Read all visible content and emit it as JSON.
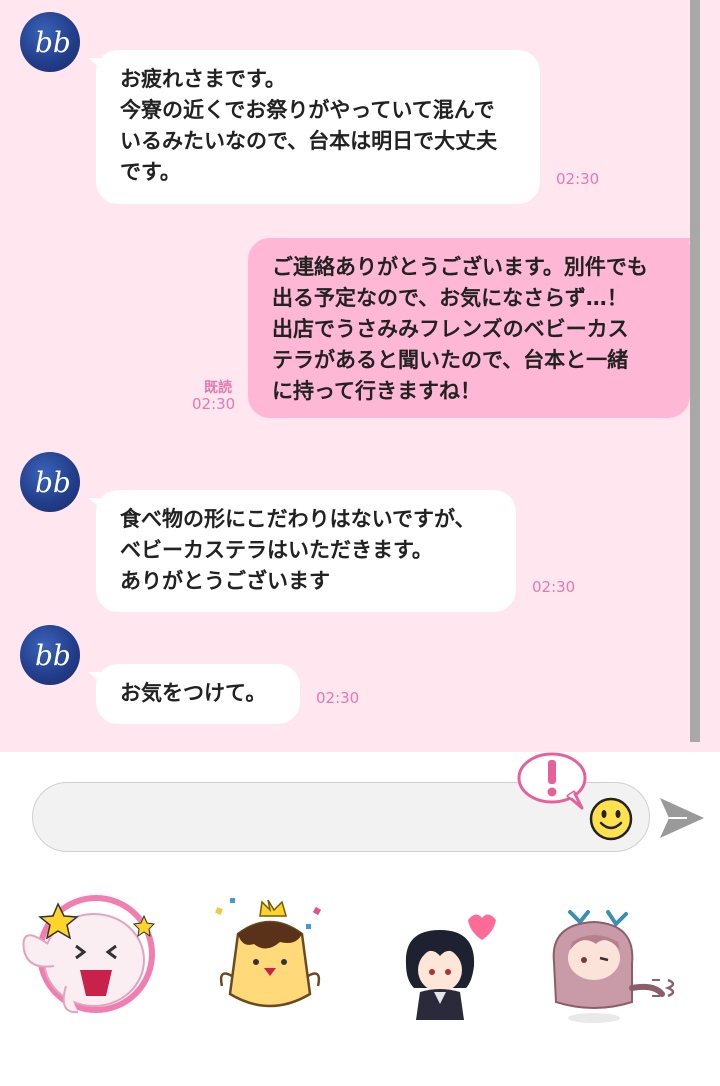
{
  "messages": [
    {
      "direction": "incoming",
      "text": "お疲れさまです。\n今寮の近くでお祭りがやっていて混んで\nいるみたいなので、台本は明日で大丈夫\nです。",
      "time": "02:30"
    },
    {
      "direction": "outgoing",
      "text": "ご連絡ありがとうございます。別件でも\n出る予定なので、お気になさらず…！\n出店でうさみみフレンズのベビーカス\nテラがあると聞いたので、台本と一緒\nに持って行きますね！",
      "time": "02:30",
      "status": "既読"
    },
    {
      "direction": "incoming",
      "text": "食べ物の形にこだわりはないですが、\nベビーカステラはいただきます。\nありがとうございます",
      "time": "02:30"
    },
    {
      "direction": "incoming",
      "text": "お気をつけて。",
      "time": "02:30"
    }
  ],
  "contact": {
    "avatar_icon": "bb-logo-icon"
  },
  "composer": {
    "placeholder": "",
    "alert_icon": "exclamation-speech-icon",
    "emoji_icon": "smiley-face-icon",
    "send_icon": "send-arrow-icon"
  },
  "stickers": [
    {
      "icon": "pink-ghost-creature-sticker"
    },
    {
      "icon": "pudding-with-crown-sticker"
    },
    {
      "icon": "dark-haired-boy-heart-sticker"
    },
    {
      "icon": "pink-monster-costume-sticker"
    }
  ],
  "colors": {
    "chat_background": "#ffe6ef",
    "outgoing_bubble": "#ffb7d6",
    "incoming_bubble": "#ffffff",
    "timestamp": "#e07ab0",
    "scrollbar": "#a8a8a8"
  }
}
